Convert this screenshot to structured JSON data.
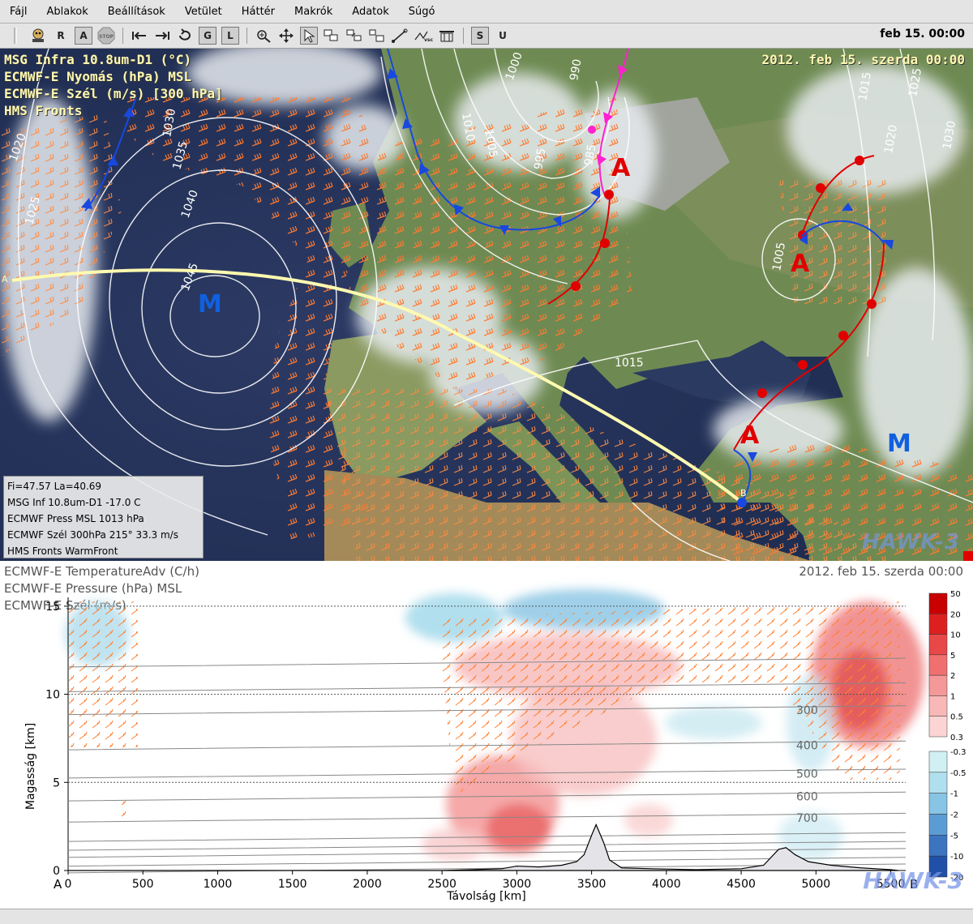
{
  "menu": [
    "Fájl",
    "Ablakok",
    "Beállítások",
    "Vetület",
    "Háttér",
    "Makrók",
    "Adatok",
    "Súgó"
  ],
  "toolbar": {
    "btn_r": "R",
    "btn_a": "A",
    "btn_stop": "STOP",
    "btn_g": "G",
    "btn_l": "L",
    "btn_s": "S",
    "btn_u": "U",
    "datetime": "feb 15. 00:00"
  },
  "map": {
    "layers": [
      "MSG Infra 10.8um-D1 (°C)",
      "ECMWF-E Nyomás (hPa) MSL",
      "ECMWF-E Szél (m/s) [300 hPa]",
      "HMS Fronts"
    ],
    "datetime": "2012. feb 15. szerda 00:00",
    "isobars": [
      "1020",
      "1030",
      "1035",
      "1040",
      "1045",
      "1025",
      "1010",
      "1005",
      "1000",
      "995",
      "990",
      "985",
      "1015",
      "1025",
      "1020",
      "1030",
      "1005",
      "1015",
      "1010"
    ],
    "systems": {
      "low_letter": "A",
      "high_letter": "M"
    },
    "section_points": [
      "A",
      "B"
    ],
    "info": [
      "Fi=47.57 La=40.69",
      "MSG Inf 10.8um-D1   -17.0 C",
      "ECMWF Press MSL   1013 hPa",
      "ECMWF Szél 300hPa   215° 33.3 m/s",
      "HMS Fronts   WarmFront"
    ],
    "watermark": "HAWK-3"
  },
  "cross_section": {
    "layers": [
      "ECMWF-E TemperatureAdv (C/h)",
      "ECMWF-E Pressure (hPa) MSL",
      "ECMWF-E Szél (m/s)"
    ],
    "datetime": "2012. feb 15. szerda 00:00",
    "watermark": "HAWK-3",
    "pressure_labels": [
      "300",
      "400",
      "500",
      "600",
      "700"
    ],
    "colorbar_positive": [
      "50",
      "20",
      "10",
      "5",
      "2",
      "1",
      "0.5",
      "0.3"
    ],
    "colorbar_negative": [
      "-0.3",
      "-0.5",
      "-1",
      "-2",
      "-5",
      "-10",
      "-20"
    ]
  },
  "chart_data": {
    "type": "heatmap",
    "xlabel": "Távolság [km]",
    "ylabel": "Magasság [km]",
    "x_ticks": [
      "0",
      "500",
      "1000",
      "1500",
      "2000",
      "2500",
      "3000",
      "3500",
      "4000",
      "4500",
      "5000",
      "5500"
    ],
    "y_ticks": [
      "0",
      "5",
      "10",
      "15"
    ],
    "xlim": [
      0,
      5600
    ],
    "ylim": [
      0,
      15.5
    ],
    "start_label": "A",
    "end_label": "B",
    "terrain": [
      [
        0,
        0
      ],
      [
        2500,
        0
      ],
      [
        2700,
        0.05
      ],
      [
        2900,
        0.1
      ],
      [
        3000,
        0.25
      ],
      [
        3150,
        0.2
      ],
      [
        3300,
        0.3
      ],
      [
        3400,
        0.5
      ],
      [
        3450,
        0.9
      ],
      [
        3500,
        2.0
      ],
      [
        3530,
        2.6
      ],
      [
        3580,
        1.6
      ],
      [
        3620,
        0.6
      ],
      [
        3700,
        0.15
      ],
      [
        3900,
        0.1
      ],
      [
        4200,
        0.05
      ],
      [
        4500,
        0.1
      ],
      [
        4650,
        0.3
      ],
      [
        4750,
        1.2
      ],
      [
        4800,
        1.3
      ],
      [
        4860,
        0.9
      ],
      [
        4950,
        0.5
      ],
      [
        5100,
        0.3
      ],
      [
        5300,
        0.15
      ],
      [
        5500,
        0.05
      ],
      [
        5550,
        0
      ]
    ],
    "isobars_hpa": [
      {
        "p": 300,
        "z": 9.1
      },
      {
        "p": 400,
        "z": 7.1
      },
      {
        "p": 500,
        "z": 5.5
      },
      {
        "p": 600,
        "z": 4.2
      },
      {
        "p": 700,
        "z": 3.0
      }
    ],
    "colorbar": {
      "positive_levels": [
        50,
        20,
        10,
        5,
        2,
        1,
        0.5,
        0.3
      ],
      "negative_levels": [
        -0.3,
        -0.5,
        -1,
        -2,
        -5,
        -10,
        -20
      ],
      "positive_colors": [
        "#c80000",
        "#dc2020",
        "#e84848",
        "#f07070",
        "#f49898",
        "#f8b8b8",
        "#fcd4d4"
      ],
      "negative_colors": [
        "#d0f0f4",
        "#b0e0ee",
        "#88c4e4",
        "#5c9cd4",
        "#3c74c0",
        "#2050a8"
      ]
    }
  }
}
